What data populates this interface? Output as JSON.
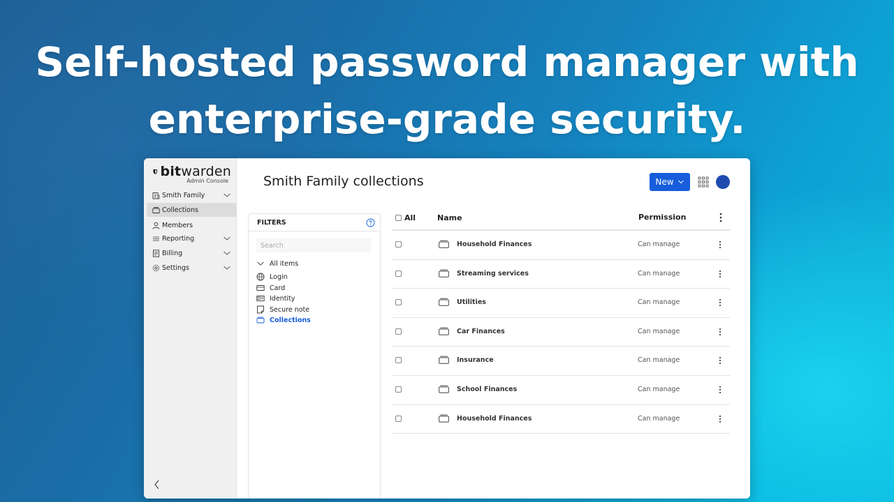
{
  "headline": {
    "line1": "Self-hosted password manager with",
    "line2": "enterprise-grade security."
  },
  "brand": {
    "name_bold": "bit",
    "name_rest": "warden",
    "subtitle": "Admin Console",
    "accent_color": "#175ddc"
  },
  "sidebar": {
    "items": [
      {
        "label": "Smith Family",
        "icon": "org-icon",
        "expandable": true
      },
      {
        "label": "Collections",
        "icon": "collections-icon",
        "active": true
      },
      {
        "label": "Members",
        "icon": "members-icon"
      },
      {
        "label": "Reporting",
        "icon": "reporting-icon",
        "expandable": true
      },
      {
        "label": "Billing",
        "icon": "billing-icon",
        "expandable": true
      },
      {
        "label": "Settings",
        "icon": "settings-icon",
        "expandable": true
      }
    ]
  },
  "header": {
    "title": "Smith Family collections",
    "new_button": "New"
  },
  "filters": {
    "title": "FILTERS",
    "search_placeholder": "Search",
    "items": [
      {
        "label": "All items",
        "icon": "chevron-down-icon"
      },
      {
        "label": "Login",
        "icon": "globe-icon"
      },
      {
        "label": "Card",
        "icon": "card-icon"
      },
      {
        "label": "Identity",
        "icon": "id-card-icon"
      },
      {
        "label": "Secure note",
        "icon": "note-icon"
      },
      {
        "label": "Collections",
        "icon": "collections-icon",
        "active": true
      }
    ]
  },
  "table": {
    "columns": {
      "all": "All",
      "name": "Name",
      "permission": "Permission"
    },
    "rows": [
      {
        "name": "Household Finances",
        "permission": "Can manage"
      },
      {
        "name": "Streaming services",
        "permission": "Can manage"
      },
      {
        "name": "Utilities",
        "permission": "Can manage"
      },
      {
        "name": "Car Finances",
        "permission": "Can manage"
      },
      {
        "name": "Insurance",
        "permission": "Can manage"
      },
      {
        "name": "School Finances",
        "permission": "Can manage"
      },
      {
        "name": "Household Finances",
        "permission": "Can manage"
      }
    ]
  }
}
